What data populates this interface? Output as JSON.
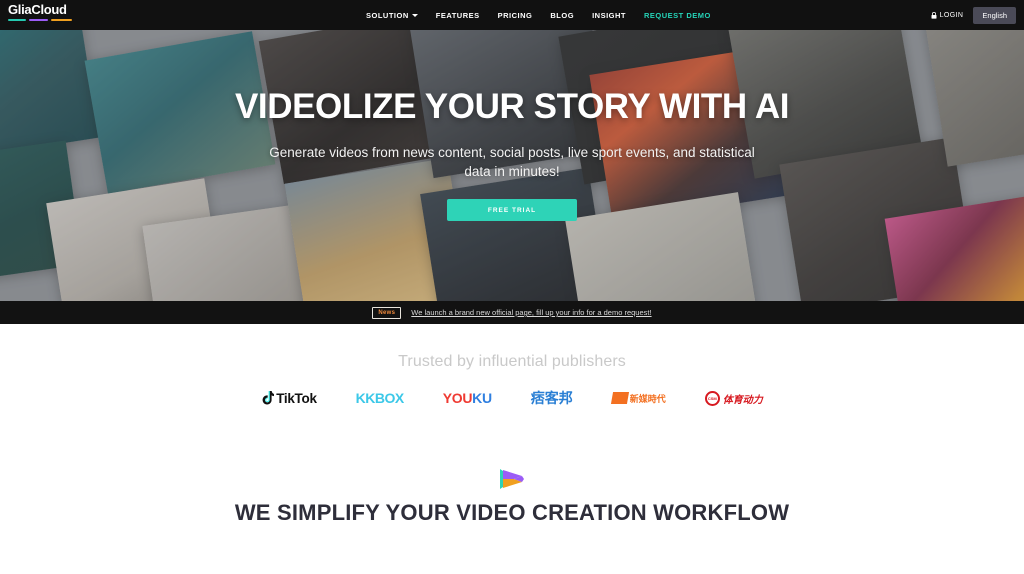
{
  "brand": {
    "name": "GliaCloud",
    "bar_colors": [
      "#25c9b0",
      "#9b5cf6",
      "#f0a020"
    ]
  },
  "nav": {
    "items": [
      {
        "label": "SOLUTION",
        "has_caret": true,
        "accent": false
      },
      {
        "label": "FEATURES",
        "has_caret": false,
        "accent": false
      },
      {
        "label": "PRICING",
        "has_caret": false,
        "accent": false
      },
      {
        "label": "BLOG",
        "has_caret": false,
        "accent": false
      },
      {
        "label": "INSIGHT",
        "has_caret": false,
        "accent": false
      },
      {
        "label": "REQUEST DEMO",
        "has_caret": false,
        "accent": true
      }
    ],
    "login_label": "LOGIN",
    "language_label": "English",
    "accent_color": "#25d3b8"
  },
  "hero": {
    "title": "VIDEOLIZE YOUR STORY WITH AI",
    "subtitle": "Generate videos from news content, social posts, live sport events, and statistical data in minutes!",
    "cta_label": "FREE TRIAL",
    "cta_color": "#2ed3b7",
    "background_color": "#8e9196"
  },
  "news_bar": {
    "badge_label": "News",
    "badge_color": "#f08a3c",
    "message": "We launch a brand new official page, fill up your info for a demo request!"
  },
  "trusted": {
    "title": "Trusted by influential publishers",
    "publishers": [
      {
        "name": "TikTok",
        "text": "TikTok",
        "color": "#111111"
      },
      {
        "name": "KKBOX",
        "text": "KKBOX",
        "color": "#3cc8e8"
      },
      {
        "name": "YOUKU",
        "text_a": "YOU",
        "text_b": "KU",
        "color_a": "#ef3a32",
        "color_b": "#2f7fe0"
      },
      {
        "name": "PIXNET",
        "text": "痞客邦",
        "color": "#2a7fd4"
      },
      {
        "name": "XinMeiTiDai",
        "text": "新媒時代",
        "color": "#f37021"
      },
      {
        "name": "CSM",
        "mark": "CSM",
        "text": "体育动力",
        "color": "#d71920"
      }
    ]
  },
  "workflow": {
    "icon": "play-icon",
    "title": "WE SIMPLIFY YOUR VIDEO CREATION WORKFLOW",
    "title_color": "#2e2e3a",
    "icon_colors": [
      "#2ed3b7",
      "#9b5cf6",
      "#f0a020"
    ]
  }
}
